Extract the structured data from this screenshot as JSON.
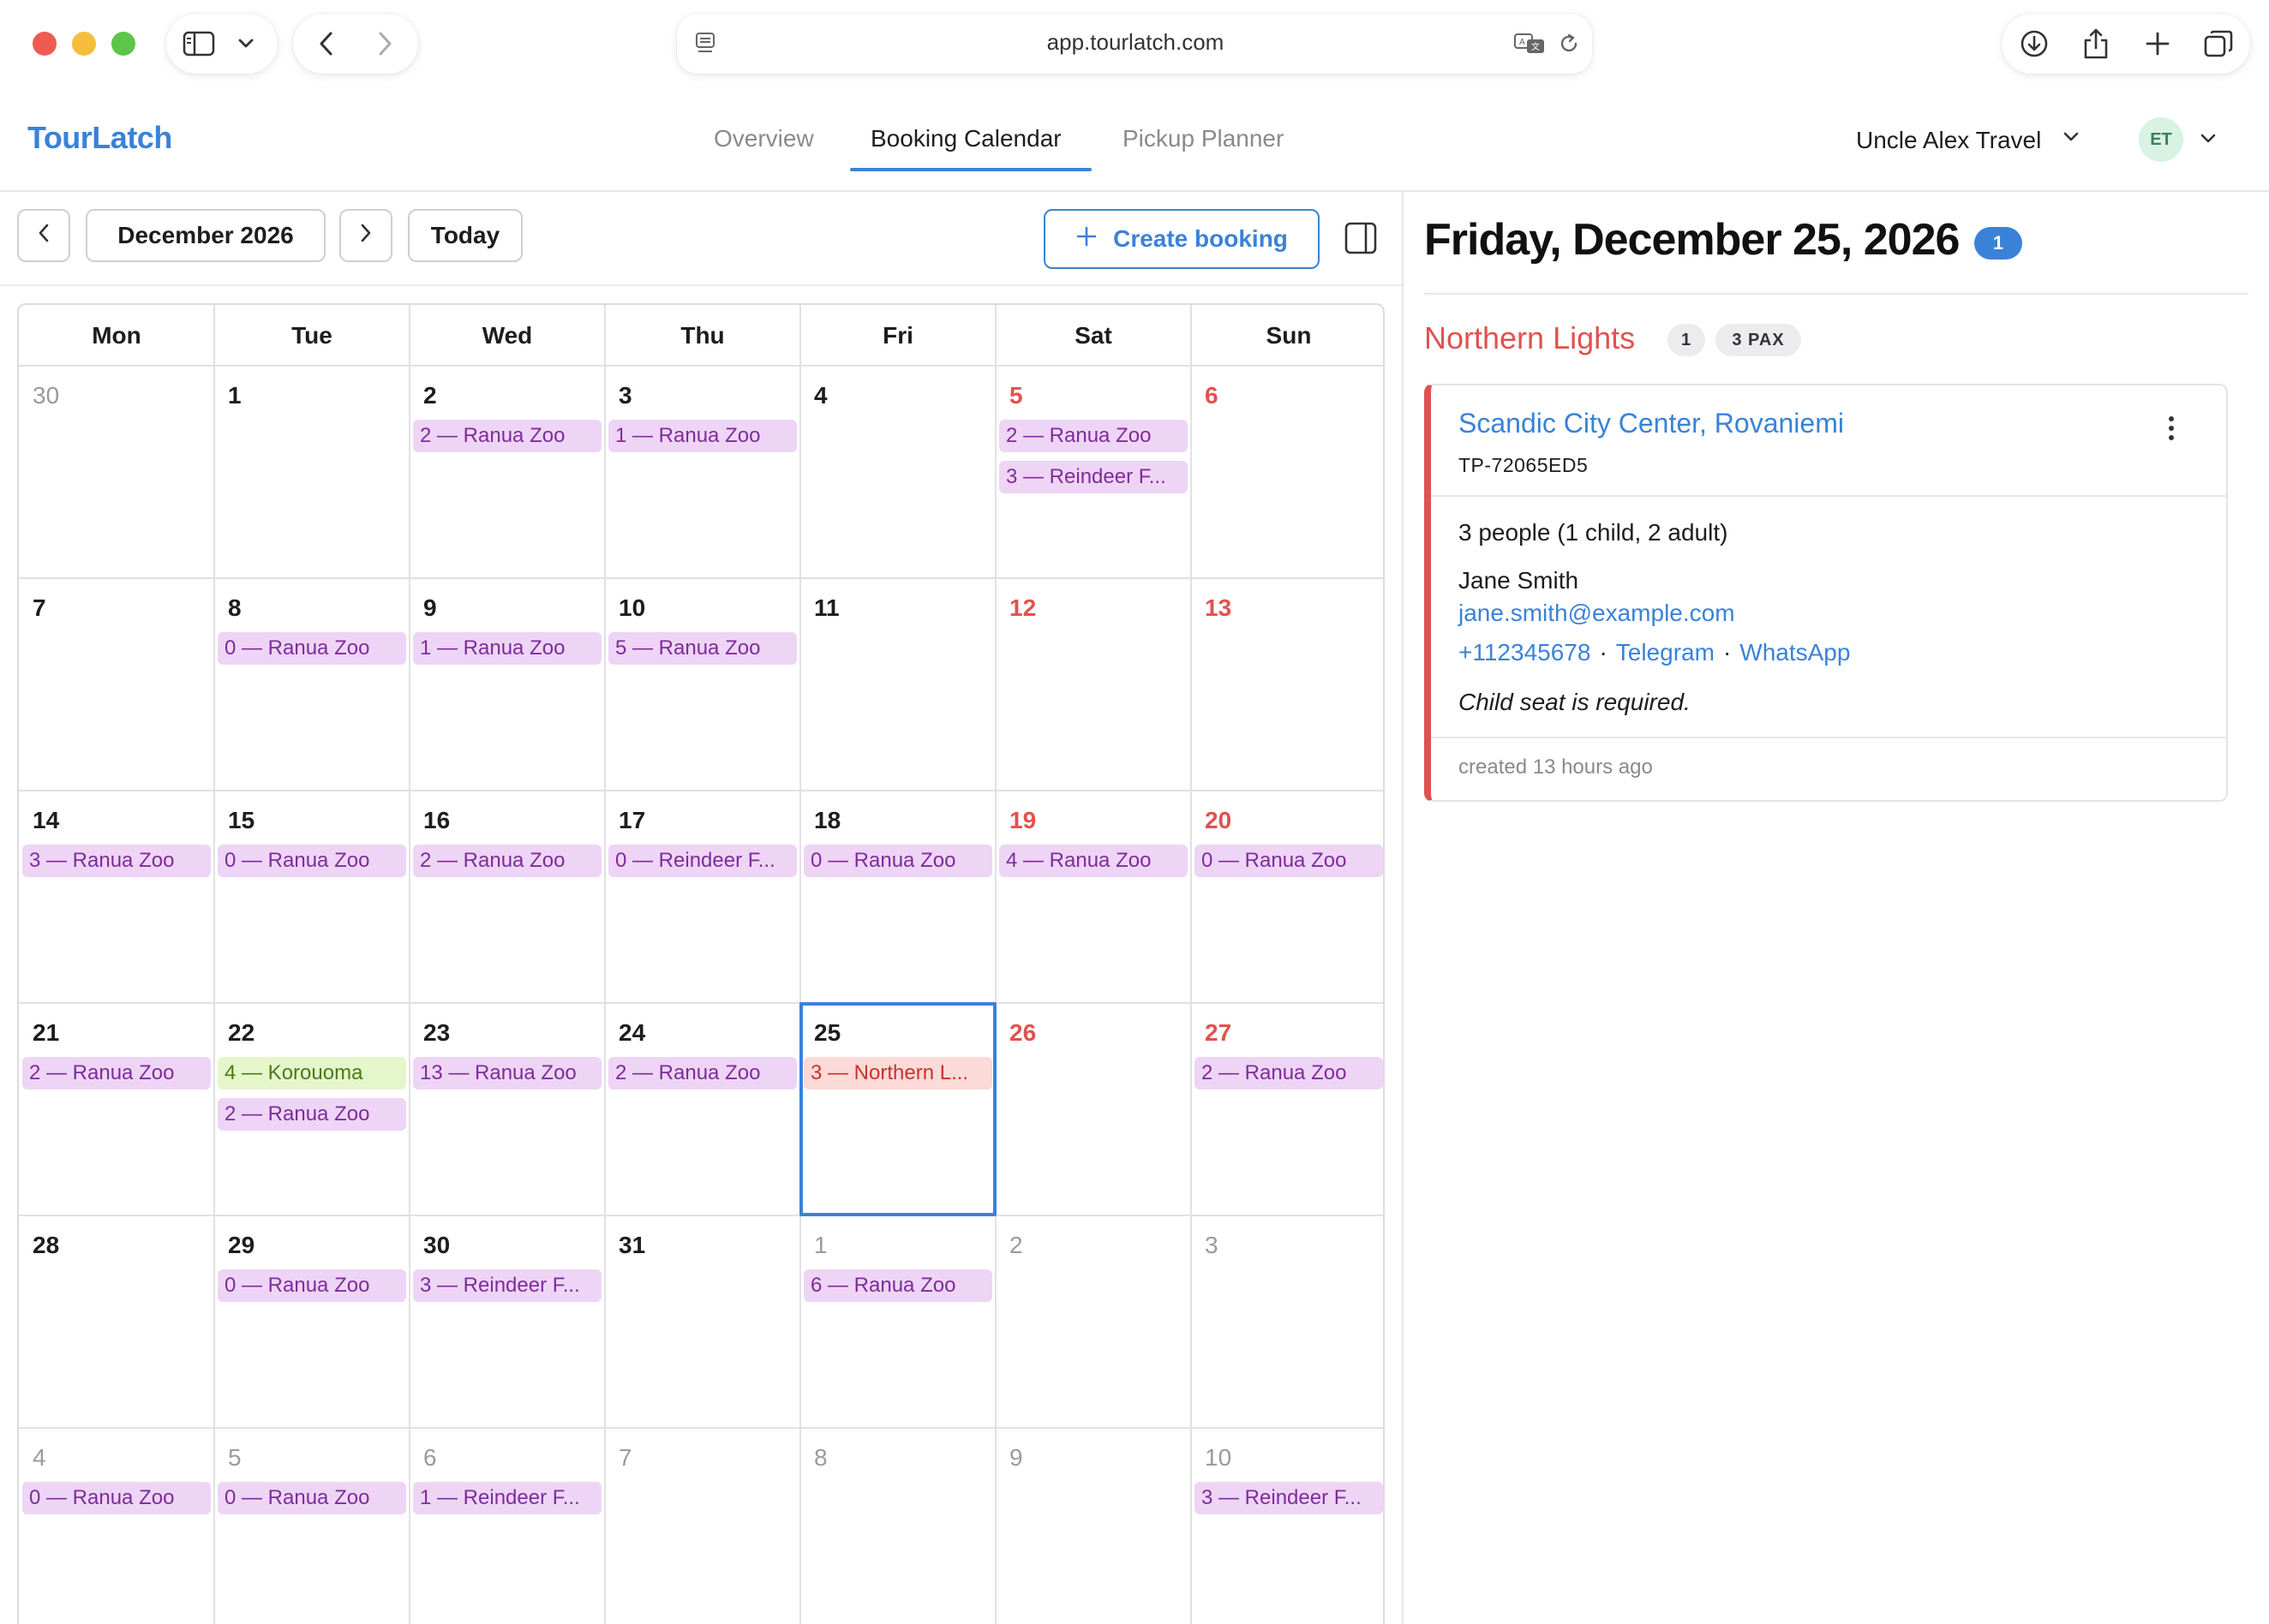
{
  "browser": {
    "url": "app.tourlatch.com"
  },
  "app": {
    "brand": "TourLatch",
    "nav_tabs": [
      "Overview",
      "Booking Calendar",
      "Pickup Planner"
    ],
    "active_tab": "Booking Calendar",
    "org_name": "Uncle Alex Travel",
    "avatar_initials": "ET"
  },
  "toolbar": {
    "month_label": "December 2026",
    "today_label": "Today",
    "create_label": "Create booking"
  },
  "calendar": {
    "weekdays": [
      "Mon",
      "Tue",
      "Wed",
      "Thu",
      "Fri",
      "Sat",
      "Sun"
    ],
    "selected_day": "25",
    "weeks": [
      [
        {
          "day": "30",
          "muted": true,
          "weekend": false,
          "events": []
        },
        {
          "day": "1",
          "muted": false,
          "weekend": false,
          "events": []
        },
        {
          "day": "2",
          "muted": false,
          "weekend": false,
          "events": [
            {
              "label": "2 — Ranua Zoo",
              "color": "purple"
            }
          ]
        },
        {
          "day": "3",
          "muted": false,
          "weekend": false,
          "events": [
            {
              "label": "1 — Ranua Zoo",
              "color": "purple"
            }
          ]
        },
        {
          "day": "4",
          "muted": false,
          "weekend": false,
          "events": []
        },
        {
          "day": "5",
          "muted": false,
          "weekend": true,
          "events": [
            {
              "label": "2 — Ranua Zoo",
              "color": "purple"
            },
            {
              "label": "3 — Reindeer F...",
              "color": "purple"
            }
          ]
        },
        {
          "day": "6",
          "muted": false,
          "weekend": true,
          "events": []
        }
      ],
      [
        {
          "day": "7",
          "muted": false,
          "weekend": false,
          "events": []
        },
        {
          "day": "8",
          "muted": false,
          "weekend": false,
          "events": [
            {
              "label": "0 — Ranua Zoo",
              "color": "purple"
            }
          ]
        },
        {
          "day": "9",
          "muted": false,
          "weekend": false,
          "events": [
            {
              "label": "1 — Ranua Zoo",
              "color": "purple"
            }
          ]
        },
        {
          "day": "10",
          "muted": false,
          "weekend": false,
          "events": [
            {
              "label": "5 — Ranua Zoo",
              "color": "purple"
            }
          ]
        },
        {
          "day": "11",
          "muted": false,
          "weekend": false,
          "events": []
        },
        {
          "day": "12",
          "muted": false,
          "weekend": true,
          "events": []
        },
        {
          "day": "13",
          "muted": false,
          "weekend": true,
          "events": []
        }
      ],
      [
        {
          "day": "14",
          "muted": false,
          "weekend": false,
          "events": [
            {
              "label": "3 — Ranua Zoo",
              "color": "purple"
            }
          ]
        },
        {
          "day": "15",
          "muted": false,
          "weekend": false,
          "events": [
            {
              "label": "0 — Ranua Zoo",
              "color": "purple"
            }
          ]
        },
        {
          "day": "16",
          "muted": false,
          "weekend": false,
          "events": [
            {
              "label": "2 — Ranua Zoo",
              "color": "purple"
            }
          ]
        },
        {
          "day": "17",
          "muted": false,
          "weekend": false,
          "events": [
            {
              "label": "0 — Reindeer F...",
              "color": "purple"
            }
          ]
        },
        {
          "day": "18",
          "muted": false,
          "weekend": false,
          "events": [
            {
              "label": "0 — Ranua Zoo",
              "color": "purple"
            }
          ]
        },
        {
          "day": "19",
          "muted": false,
          "weekend": true,
          "events": [
            {
              "label": "4 — Ranua Zoo",
              "color": "purple"
            }
          ]
        },
        {
          "day": "20",
          "muted": false,
          "weekend": true,
          "events": [
            {
              "label": "0 — Ranua Zoo",
              "color": "purple"
            }
          ]
        }
      ],
      [
        {
          "day": "21",
          "muted": false,
          "weekend": false,
          "events": [
            {
              "label": "2 — Ranua Zoo",
              "color": "purple"
            }
          ]
        },
        {
          "day": "22",
          "muted": false,
          "weekend": false,
          "events": [
            {
              "label": "4 — Korouoma",
              "color": "green"
            },
            {
              "label": "2 — Ranua Zoo",
              "color": "purple"
            }
          ]
        },
        {
          "day": "23",
          "muted": false,
          "weekend": false,
          "events": [
            {
              "label": "13 — Ranua Zoo",
              "color": "purple"
            }
          ]
        },
        {
          "day": "24",
          "muted": false,
          "weekend": false,
          "events": [
            {
              "label": "2 — Ranua Zoo",
              "color": "purple"
            }
          ]
        },
        {
          "day": "25",
          "muted": false,
          "weekend": false,
          "events": [
            {
              "label": "3 — Northern L...",
              "color": "red"
            }
          ]
        },
        {
          "day": "26",
          "muted": false,
          "weekend": true,
          "events": []
        },
        {
          "day": "27",
          "muted": false,
          "weekend": true,
          "events": [
            {
              "label": "2 — Ranua Zoo",
              "color": "purple"
            }
          ]
        }
      ],
      [
        {
          "day": "28",
          "muted": false,
          "weekend": false,
          "events": []
        },
        {
          "day": "29",
          "muted": false,
          "weekend": false,
          "events": [
            {
              "label": "0 — Ranua Zoo",
              "color": "purple"
            }
          ]
        },
        {
          "day": "30",
          "muted": false,
          "weekend": false,
          "events": [
            {
              "label": "3 — Reindeer F...",
              "color": "purple"
            }
          ]
        },
        {
          "day": "31",
          "muted": false,
          "weekend": false,
          "events": []
        },
        {
          "day": "1",
          "muted": true,
          "weekend": false,
          "events": [
            {
              "label": "6 — Ranua Zoo",
              "color": "purple"
            }
          ]
        },
        {
          "day": "2",
          "muted": true,
          "weekend": false,
          "events": []
        },
        {
          "day": "3",
          "muted": true,
          "weekend": false,
          "events": []
        }
      ],
      [
        {
          "day": "4",
          "muted": true,
          "weekend": false,
          "events": [
            {
              "label": "0 — Ranua Zoo",
              "color": "purple"
            }
          ]
        },
        {
          "day": "5",
          "muted": true,
          "weekend": false,
          "events": [
            {
              "label": "0 — Ranua Zoo",
              "color": "purple"
            }
          ]
        },
        {
          "day": "6",
          "muted": true,
          "weekend": false,
          "events": [
            {
              "label": "1 — Reindeer F...",
              "color": "purple"
            }
          ]
        },
        {
          "day": "7",
          "muted": true,
          "weekend": false,
          "events": []
        },
        {
          "day": "8",
          "muted": true,
          "weekend": false,
          "events": []
        },
        {
          "day": "9",
          "muted": true,
          "weekend": false,
          "events": []
        },
        {
          "day": "10",
          "muted": true,
          "weekend": false,
          "events": [
            {
              "label": "3 — Reindeer F...",
              "color": "purple"
            }
          ]
        }
      ]
    ]
  },
  "detail": {
    "date_title": "Friday, December 25, 2026",
    "count": "1",
    "tour_name": "Northern Lights",
    "tour_count": "1",
    "pax": "3 PAX",
    "booking": {
      "hotel": "Scandic City Center, Rovaniemi",
      "ref": "TP-72065ED5",
      "people": "3 people (1 child, 2 adult)",
      "customer": "Jane Smith",
      "email": "jane.smith@example.com",
      "phone": "+112345678",
      "telegram": "Telegram",
      "whatsapp": "WhatsApp",
      "separator": "·",
      "note": "Child seat is required.",
      "created": "created 13 hours ago"
    }
  },
  "colors": {
    "accent": "#3a82d8",
    "weekend": "#e0524f",
    "event_purple_bg": "#eed5f6",
    "event_purple_text": "#7e2c9b",
    "event_green_bg": "#e5f6cb",
    "event_green_text": "#4b7a17",
    "event_red_bg": "#fbdad7",
    "event_red_text": "#c8322f"
  },
  "icons": [
    "sidebar-icon",
    "chevron-down-icon",
    "back-arrow-icon",
    "forward-arrow-icon",
    "page-icon",
    "translate-icon",
    "reload-icon",
    "download-icon",
    "share-icon",
    "plus-icon",
    "tabs-icon",
    "chevron-left-icon",
    "chevron-right-icon",
    "panel-toggle-icon",
    "kebab-menu-icon"
  ]
}
